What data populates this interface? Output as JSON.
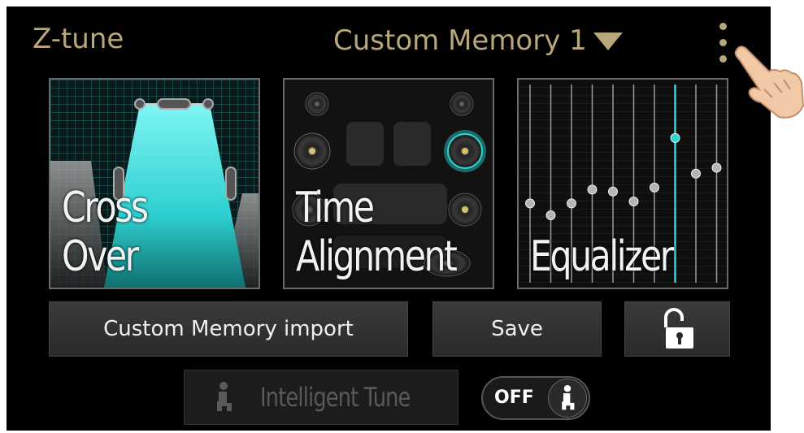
{
  "header": {
    "app_title": "Z-tune",
    "memory_selected": "Custom Memory 1"
  },
  "tiles": [
    {
      "label_line1": "Cross",
      "label_line2": "Over"
    },
    {
      "label_line1": "Time",
      "label_line2": "Alignment"
    },
    {
      "label_line1": "Equalizer"
    }
  ],
  "equalizer": {
    "levels": [
      0.4,
      0.34,
      0.4,
      0.47,
      0.46,
      0.41,
      0.48,
      0.73,
      0.55,
      0.58
    ],
    "selected_band": 7,
    "accent_color": "#2fd6d6"
  },
  "buttons": {
    "import_label": "Custom Memory import",
    "save_label": "Save",
    "lock_icon": "unlocked-padlock-icon"
  },
  "intelligent_tune": {
    "label": "Intelligent Tune",
    "toggle_label": "OFF",
    "toggle_state": "off"
  },
  "colors": {
    "title_gold": "#b8a77a",
    "accent_cyan": "#2fd6d6"
  }
}
